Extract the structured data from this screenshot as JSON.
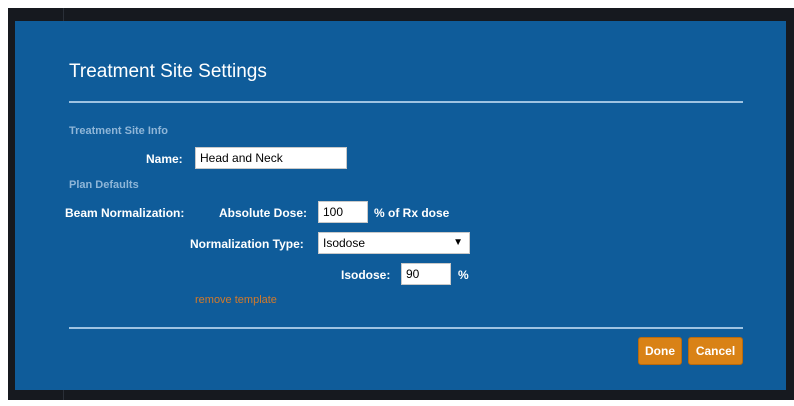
{
  "dialog": {
    "title": "Treatment Site Settings",
    "section_site_info": "Treatment Site Info",
    "name_label": "Name:",
    "name_value": "Head and Neck",
    "section_plan_defaults": "Plan Defaults",
    "beam_normalization_label": "Beam Normalization:",
    "absolute_dose_label": "Absolute Dose:",
    "absolute_dose_value": "100",
    "absolute_dose_unit": "% of Rx dose",
    "normalization_type_label": "Normalization Type:",
    "normalization_type_selected": "Isodose",
    "isodose_label": "Isodose:",
    "isodose_value": "90",
    "isodose_unit": "%",
    "remove_template_link": "remove template",
    "done_button": "Done",
    "cancel_button": "Cancel"
  },
  "icons": {
    "dropdown": "chevron-down-icon"
  },
  "colors": {
    "dialog_background": "#0f5c9a",
    "section_heading": "#8fb6d8",
    "link": "#d37a2a",
    "button": "#d98216"
  }
}
